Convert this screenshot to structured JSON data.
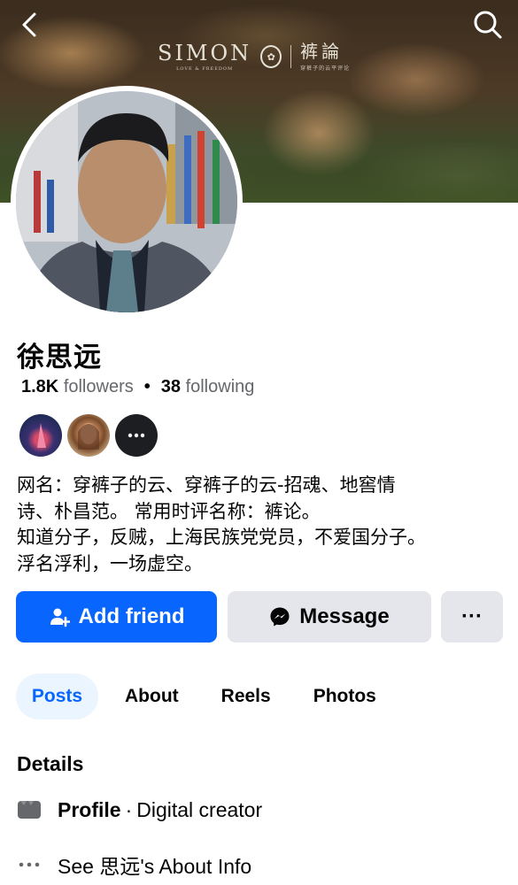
{
  "cover": {
    "logo_text": "SIMON",
    "logo_subtext": "LOVE & FREEDOM",
    "logo_cn": "裤論",
    "logo_cn_sub": "穿裤子的云平评论"
  },
  "profile": {
    "name": "徐思远",
    "followers_count": "1.8K",
    "followers_label": "followers",
    "following_count": "38",
    "following_label": "following",
    "bio_lines": [
      "网名：穿裤子的云、穿裤子的云-招魂、地窖情",
      "诗、朴昌范。  常用时评名称：裤论。",
      "知道分子，反贼，上海民族党党员，不爱国分子。",
      "浮名浮利，一场虚空。"
    ]
  },
  "actions": {
    "add_friend": "Add friend",
    "message": "Message",
    "more": "···"
  },
  "tabs": [
    {
      "label": "Posts",
      "active": true
    },
    {
      "label": "About",
      "active": false
    },
    {
      "label": "Reels",
      "active": false
    },
    {
      "label": "Photos",
      "active": false
    }
  ],
  "details": {
    "heading": "Details",
    "profile_label": "Profile",
    "profile_separator": "·",
    "profile_category": "Digital creator",
    "about_info": "See 思远's About Info"
  },
  "icons": {
    "back": "chevron-left-icon",
    "search": "search-icon",
    "add_friend": "person-plus-icon",
    "message": "messenger-icon",
    "more": "more-dots-icon",
    "profile": "category-icon",
    "about": "dots-icon"
  },
  "colors": {
    "accent": "#0866ff",
    "secondary_button": "#e4e6eb",
    "active_tab_bg": "#ebf5ff",
    "muted_text": "#65676b"
  }
}
